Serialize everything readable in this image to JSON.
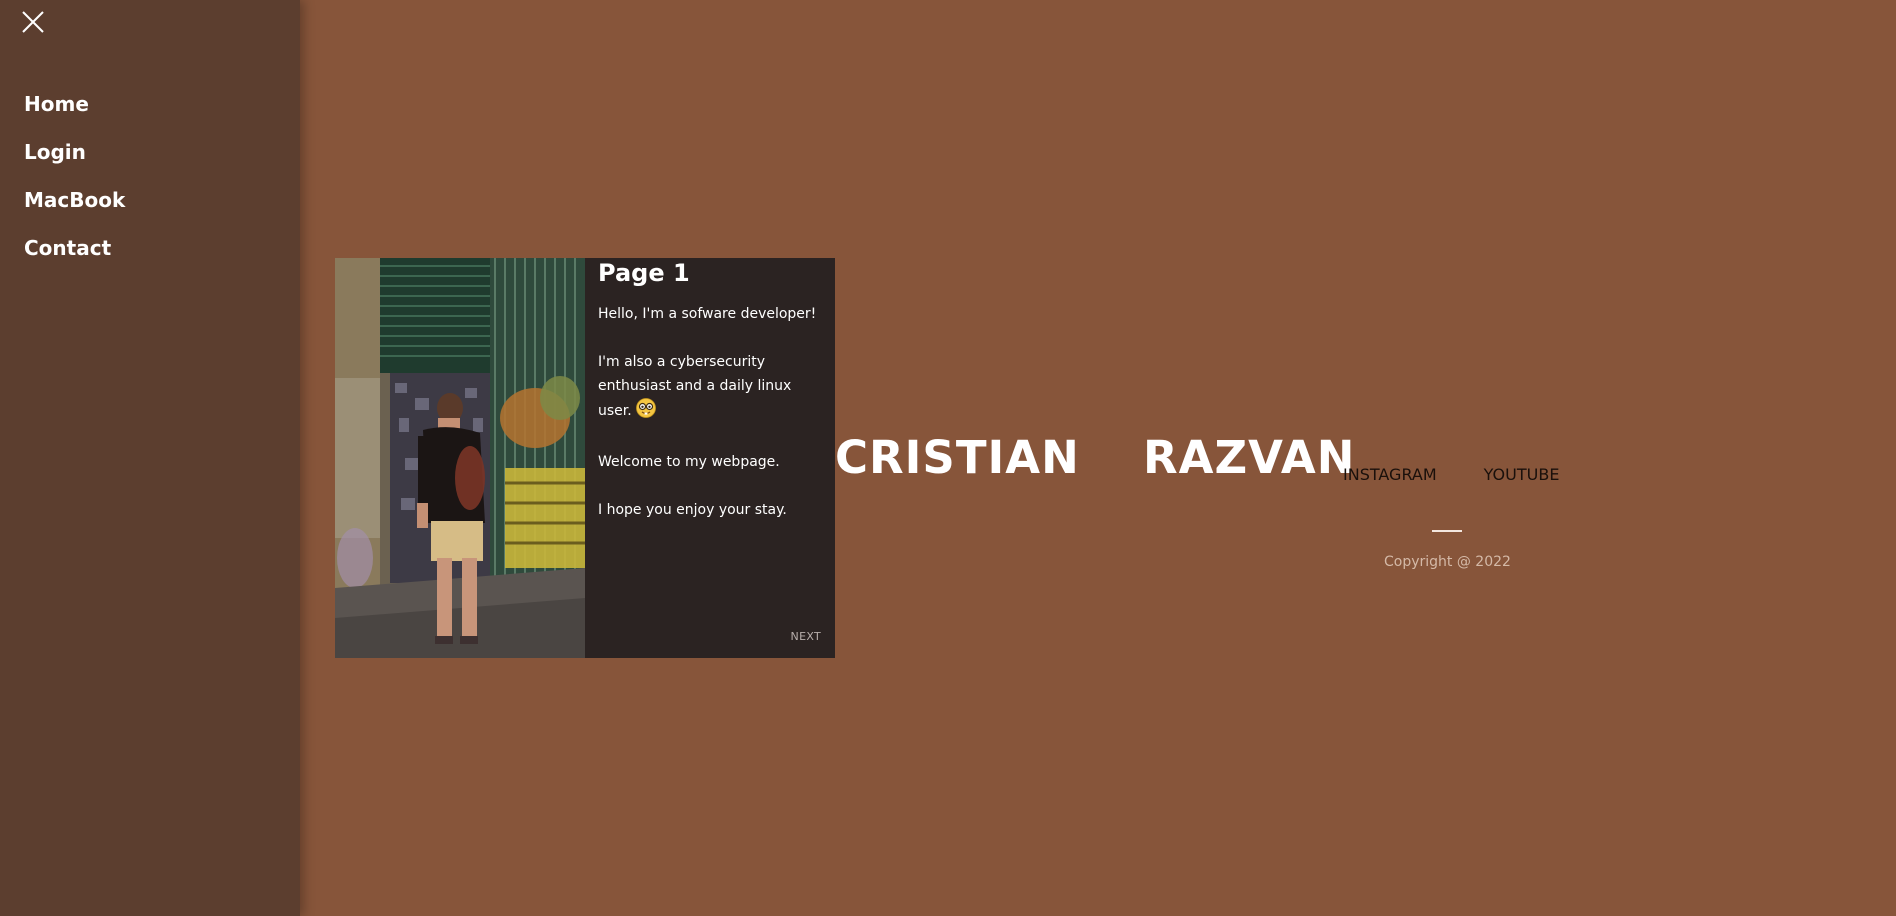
{
  "sidebar": {
    "close_icon": "close-icon",
    "items": [
      {
        "label": "Home"
      },
      {
        "label": "Login"
      },
      {
        "label": "MacBook"
      },
      {
        "label": "Contact"
      }
    ]
  },
  "card": {
    "title": "Page 1",
    "paragraphs": [
      "Hello, I'm a sofware developer!",
      "I'm also a cybersecurity enthusiast and a daily linux user.",
      "Welcome to my webpage.",
      "I hope you enjoy your stay."
    ],
    "emoji": "nerd-face-icon",
    "next_label": "NEXT"
  },
  "hero": {
    "first_name": "CRISTIAN",
    "last_name": "RAZVAN"
  },
  "social": {
    "instagram": "INSTAGRAM",
    "youtube": "YOUTUBE"
  },
  "footer": {
    "copyright": "Copyright @ 2022"
  },
  "colors": {
    "background": "#87553a",
    "sidebar": "#5c3e2f",
    "card_body": "#2b2322"
  }
}
